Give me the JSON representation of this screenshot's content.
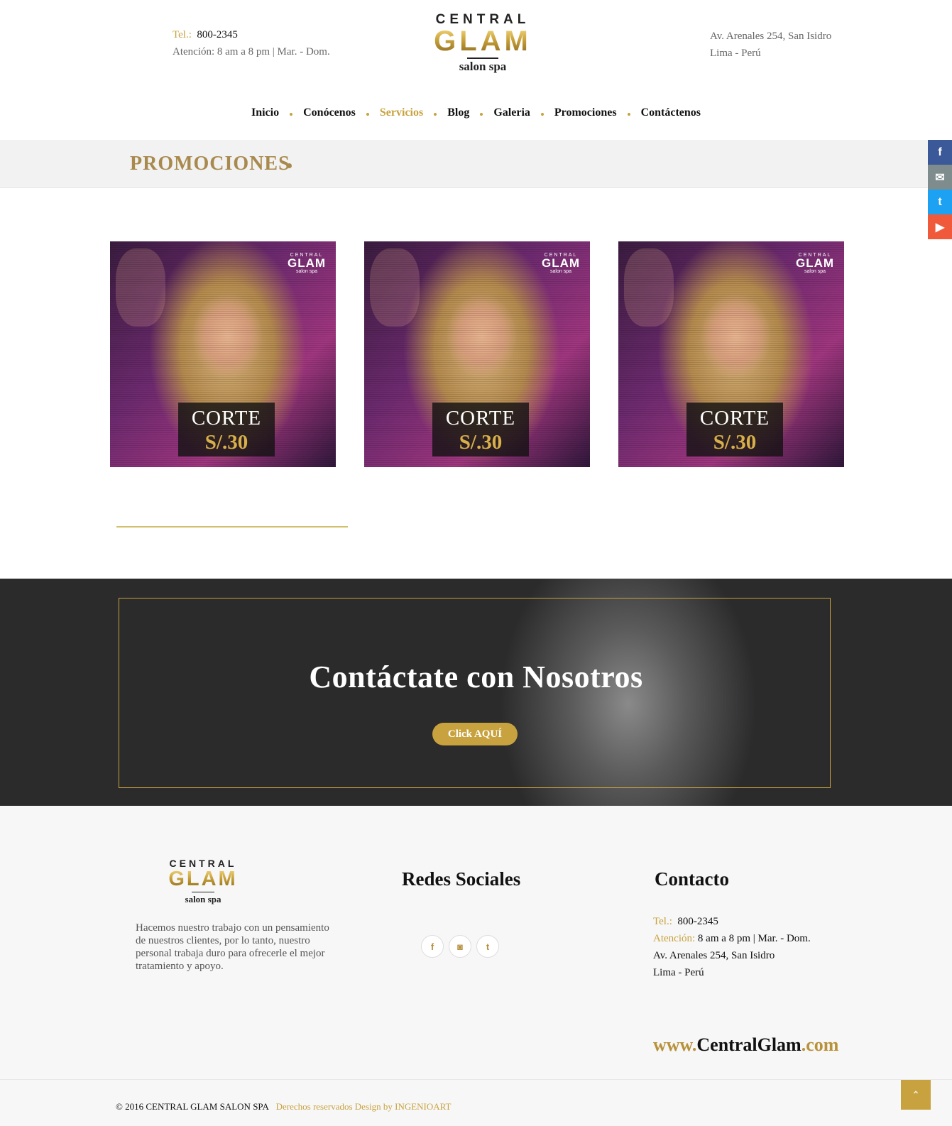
{
  "header": {
    "tel_label": "Tel.:",
    "tel": "800-2345",
    "hours": "Atención: 8 am a 8 pm  |  Mar. - Dom.",
    "address_line1": "Av. Arenales  254, San Isidro",
    "address_line2": "Lima - Perú",
    "logo": {
      "central": "CENTRAL",
      "glam": "GLAM",
      "spa": "salon spa"
    }
  },
  "nav": {
    "items": [
      "Inicio",
      "Conócenos",
      "Servicios",
      "Blog",
      "Galeria",
      "Promociones",
      "Contáctenos"
    ],
    "active": "Servicios"
  },
  "page": {
    "title": "PROMOCIONES"
  },
  "side_social": [
    {
      "icon": "facebook-icon",
      "glyph": "f",
      "color": "#3b5998"
    },
    {
      "icon": "email-icon",
      "glyph": "✉",
      "color": "#7f8c8d"
    },
    {
      "icon": "twitter-icon",
      "glyph": "t",
      "color": "#1da1f2"
    },
    {
      "icon": "youtube-icon",
      "glyph": "▶",
      "color": "#f05a3a"
    }
  ],
  "promos": [
    {
      "logo_central": "CENTRAL",
      "logo_glam": "GLAM",
      "logo_spa": "salon spa",
      "line1": "CORTE",
      "line2": "S/.30"
    },
    {
      "logo_central": "CENTRAL",
      "logo_glam": "GLAM",
      "logo_spa": "salon spa",
      "line1": "CORTE",
      "line2": "S/.30"
    },
    {
      "logo_central": "CENTRAL",
      "logo_glam": "GLAM",
      "logo_spa": "salon spa",
      "line1": "CORTE",
      "line2": "S/.30"
    }
  ],
  "contact_banner": {
    "title": "Contáctate con Nosotros",
    "button": "Click AQUÍ"
  },
  "footer": {
    "logo": {
      "central": "CENTRAL",
      "glam": "GLAM",
      "spa": "salon spa"
    },
    "about": "Hacemos nuestro trabajo con un pensamiento de nuestros clientes, por lo tanto, nuestro personal trabaja duro para ofrecerle el mejor tratamiento y apoyo.",
    "social_title": "Redes Sociales",
    "social_icons": [
      {
        "icon": "facebook-icon",
        "glyph": "f"
      },
      {
        "icon": "instagram-icon",
        "glyph": "◙"
      },
      {
        "icon": "tumblr-icon",
        "glyph": "t"
      }
    ],
    "contact_title": "Contacto",
    "tel_label": "Tel.:",
    "tel": "800-2345",
    "hours_label": "Atención:",
    "hours": "8 am a 8 pm  |  Mar. - Dom.",
    "address_line1": "Av. Arenales  254, San Isidro",
    "address_line2": "Lima - Perú",
    "site_prefix": "www.",
    "site_name": "CentralGlam",
    "site_suffix": ".com"
  },
  "copyright": {
    "text": "© 2016   CENTRAL GLAM SALON SPA",
    "credit": "Derechos reservados Design by INGENIOART"
  },
  "to_top_glyph": "⌃"
}
